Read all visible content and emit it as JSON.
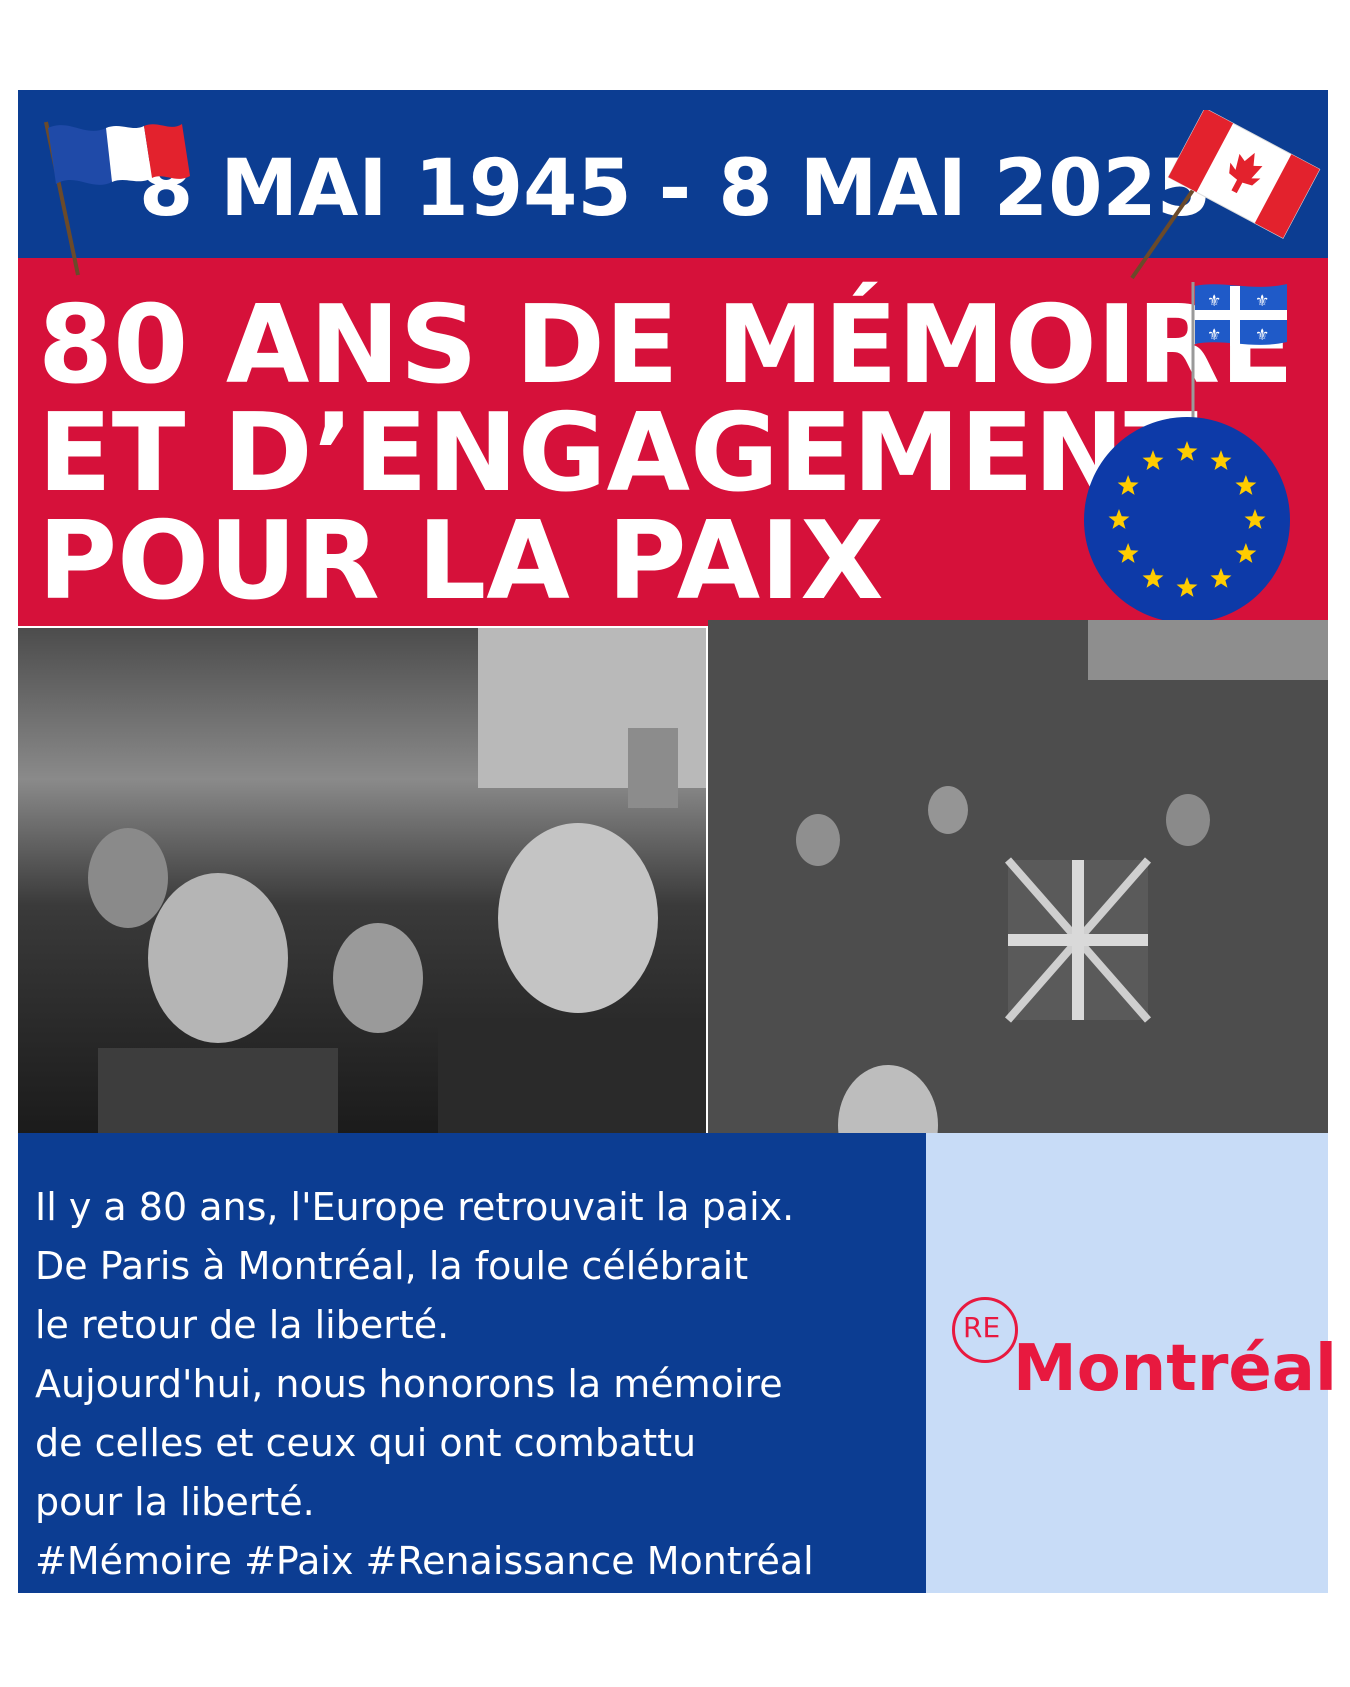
{
  "header": {
    "dates": "8 MAI 1945 - 8 MAI 2025",
    "headline_lines": [
      "80 ANS DE MÉMOIRE",
      "ET D’ENGAGEMENT",
      "POUR LA PAIX"
    ]
  },
  "flags": [
    "france-flag-icon",
    "canada-flag-icon",
    "quebec-flag-icon",
    "eu-flag-icon"
  ],
  "photos": [
    "celebrating-crowd-photo",
    "crowd-with-union-jack-photo"
  ],
  "body": {
    "lines": [
      "Il y a 80 ans, l'Europe retrouvait la paix.",
      "De Paris à Montréal, la foule célébrait",
      "le retour de la liberté.",
      "Aujourd'hui, nous honorons la mémoire",
      "de celles et ceux qui ont combattu",
      "pour la liberté.",
      "#Mémoire #Paix #Renaissance Montréal"
    ]
  },
  "logo": {
    "prefix": "RE",
    "name": "Montréal"
  },
  "colors": {
    "blue": "#0c3d92",
    "red": "#d6113a",
    "light_blue": "#c8dcf7",
    "logo_red": "#e8193f",
    "eu_gold": "#ffcc00"
  }
}
